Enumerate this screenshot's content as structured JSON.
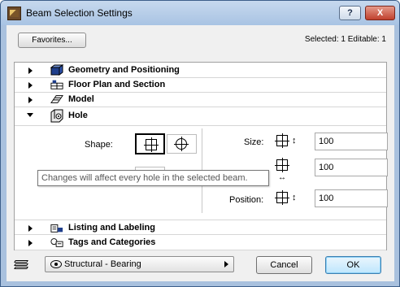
{
  "window": {
    "title": "Beam Selection Settings",
    "help_label": "?",
    "close_label": "X"
  },
  "toolbar": {
    "favorites_label": "Favorites...",
    "selected_info": "Selected: 1 Editable: 1"
  },
  "sections": [
    {
      "label": "Geometry and Positioning",
      "icon": "geometry-icon",
      "expanded": false
    },
    {
      "label": "Floor Plan and Section",
      "icon": "floor-plan-icon",
      "expanded": false
    },
    {
      "label": "Model",
      "icon": "model-icon",
      "expanded": false
    },
    {
      "label": "Hole",
      "icon": "hole-icon",
      "expanded": true
    },
    {
      "label": "Listing and Labeling",
      "icon": "listing-icon",
      "expanded": false
    },
    {
      "label": "Tags and Categories",
      "icon": "tags-icon",
      "expanded": false
    }
  ],
  "hole": {
    "shape_label": "Shape:",
    "size_label": "Size:",
    "position_label": "Position:",
    "size_width_value": "100",
    "size_height_value": "100",
    "position_value": "100",
    "warning_icon": "warning-icon"
  },
  "tooltip": {
    "text": "Changes will affect every hole in the selected beam."
  },
  "footer": {
    "layer_value": "Structural - Bearing",
    "cancel_label": "Cancel",
    "ok_label": "OK"
  },
  "colors": {
    "title_bar": "#a8c3e3",
    "close_button": "#c0402d",
    "warning": "#f5c518",
    "ok_focus": "#3c7fb1"
  }
}
